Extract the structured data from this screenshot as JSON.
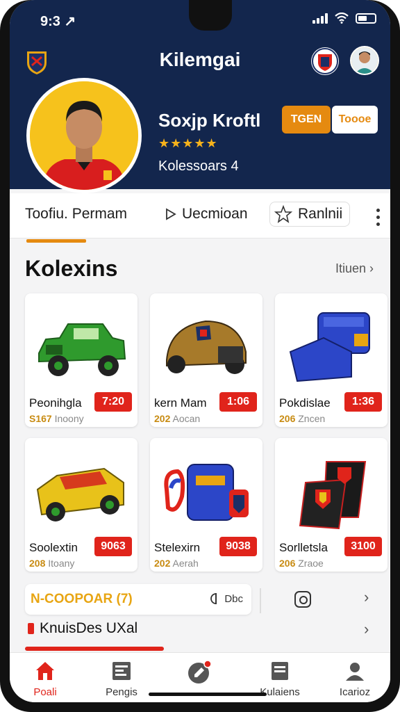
{
  "status": {
    "time": "9:3 ↗"
  },
  "header": {
    "app_title": "Kilemgai",
    "player_name": "Soxjp Kroftl",
    "rating": "★★★★★",
    "player_sub": "Kolessoars 4",
    "btn_primary": "TGEN",
    "btn_secondary": "Toooe"
  },
  "tabs": {
    "tab1": "Toofiu. Permam",
    "tab2": "Uecmioan",
    "tab3": "Ranlnii"
  },
  "section": {
    "title": "Kolexins",
    "view_all": "Itiuen"
  },
  "cards": [
    {
      "name": "Peonihgla",
      "price": "7:20",
      "meta_num": "S167",
      "meta_txt": "Inoony"
    },
    {
      "name": "kern Mam",
      "price": "1:06",
      "meta_num": "202",
      "meta_txt": "Aocan"
    },
    {
      "name": "Pokdislae",
      "price": "1:36",
      "meta_num": "206",
      "meta_txt": "Zncen"
    },
    {
      "name": "Soolextin",
      "price": "9063",
      "meta_num": "208",
      "meta_txt": "Itoany"
    },
    {
      "name": "Stelexirn",
      "price": "9038",
      "meta_num": "202",
      "meta_txt": "Aerah"
    },
    {
      "name": "Sorlletsla",
      "price": "3100",
      "meta_num": "206",
      "meta_txt": "Zraoe"
    }
  ],
  "promo": {
    "text": "N-COOPOAR (7)",
    "chip": "Dbc"
  },
  "link_row": {
    "text": "KnuisDes UXal"
  },
  "nav": [
    {
      "label": "Poali"
    },
    {
      "label": "Pengis"
    },
    {
      "label": ""
    },
    {
      "label": "Kulaiens"
    },
    {
      "label": "Icarioz"
    }
  ],
  "colors": {
    "header_bg": "#13264d",
    "accent_orange": "#e58a10",
    "accent_red": "#e0241b",
    "gold": "#f6b21b"
  }
}
